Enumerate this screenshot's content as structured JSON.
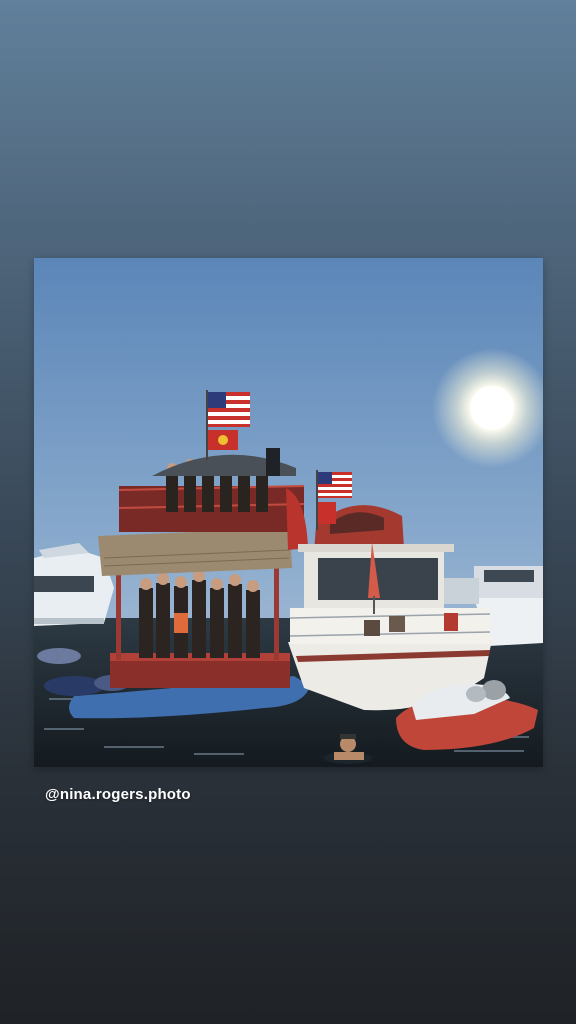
{
  "story": {
    "photo_credit": "@nina.rogers.photo",
    "photo_subject": "party-boat-photo"
  },
  "colors": {
    "background_top": "#61809b",
    "background_bottom": "#1f2226",
    "credit_text": "#ffffff"
  }
}
